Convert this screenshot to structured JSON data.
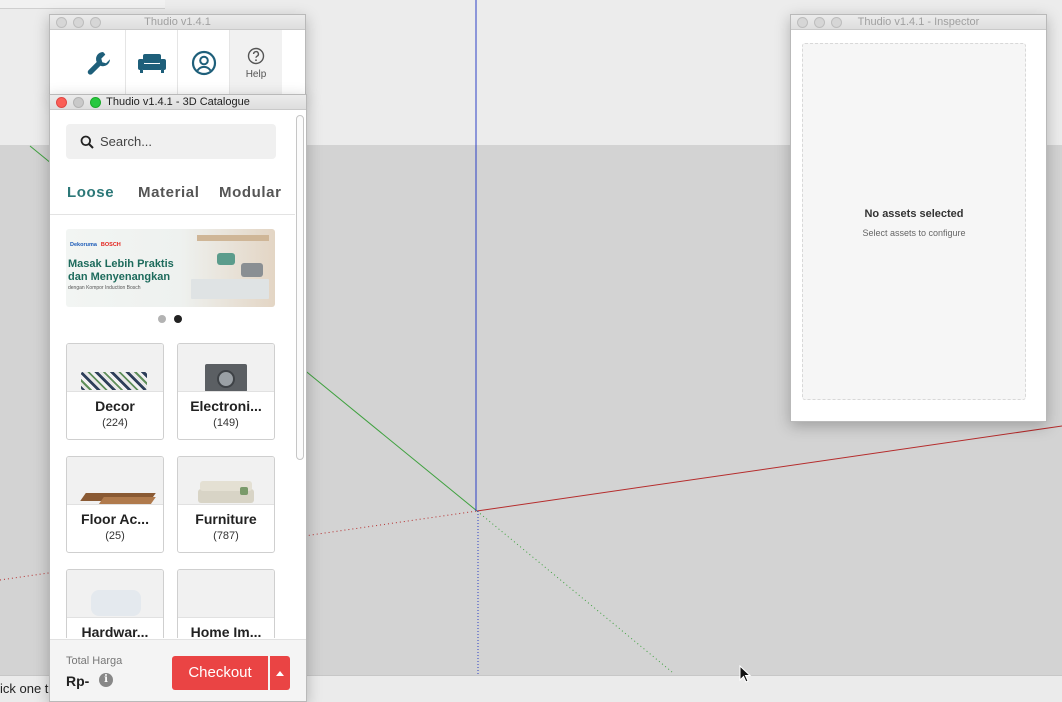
{
  "viewport": {
    "status_text": "ick one t",
    "axis_colors": {
      "red": "#b52c2c",
      "green": "#3fa13f",
      "blue": "#2b3fc6"
    },
    "sky_color": "#ececec",
    "ground_color": "#d3d3d3"
  },
  "toolbar_window": {
    "title": "Thudio v1.4.1",
    "tools": [
      {
        "icon": "wrench-icon"
      },
      {
        "icon": "sofa-icon"
      },
      {
        "icon": "account-icon"
      },
      {
        "icon": "help-icon",
        "label": "Help"
      }
    ]
  },
  "catalogue": {
    "title": "Thudio v1.4.1 - 3D Catalogue",
    "search": {
      "placeholder": "Search...",
      "value": ""
    },
    "tabs": [
      {
        "label": "Loose",
        "active": true
      },
      {
        "label": "Material",
        "active": false
      },
      {
        "label": "Modular",
        "active": false
      }
    ],
    "banner": {
      "brand": "Dekoruma",
      "brand2": "BOSCH",
      "headline": "Masak Lebih Praktis\ndan Menyenangkan",
      "sub": "dengan Kompor Induction Bosch"
    },
    "carousel": {
      "count": 2,
      "active_index": 1
    },
    "categories": [
      {
        "name": "Decor",
        "count": "(224)"
      },
      {
        "name": "Electroni...",
        "count": "(149)"
      },
      {
        "name": "Floor Ac...",
        "count": "(25)"
      },
      {
        "name": "Furniture",
        "count": "(787)"
      },
      {
        "name": "Hardwar...",
        "count": ""
      },
      {
        "name": "Home Im...",
        "count": ""
      }
    ],
    "footer": {
      "total_label": "Total Harga",
      "total_value": "Rp-",
      "checkout_label": "Checkout"
    },
    "accent_color": "#2c7878",
    "checkout_color": "#ea4444"
  },
  "inspector": {
    "title": "Thudio v1.4.1 - Inspector",
    "empty_title": "No assets selected",
    "empty_sub": "Select assets to configure"
  }
}
